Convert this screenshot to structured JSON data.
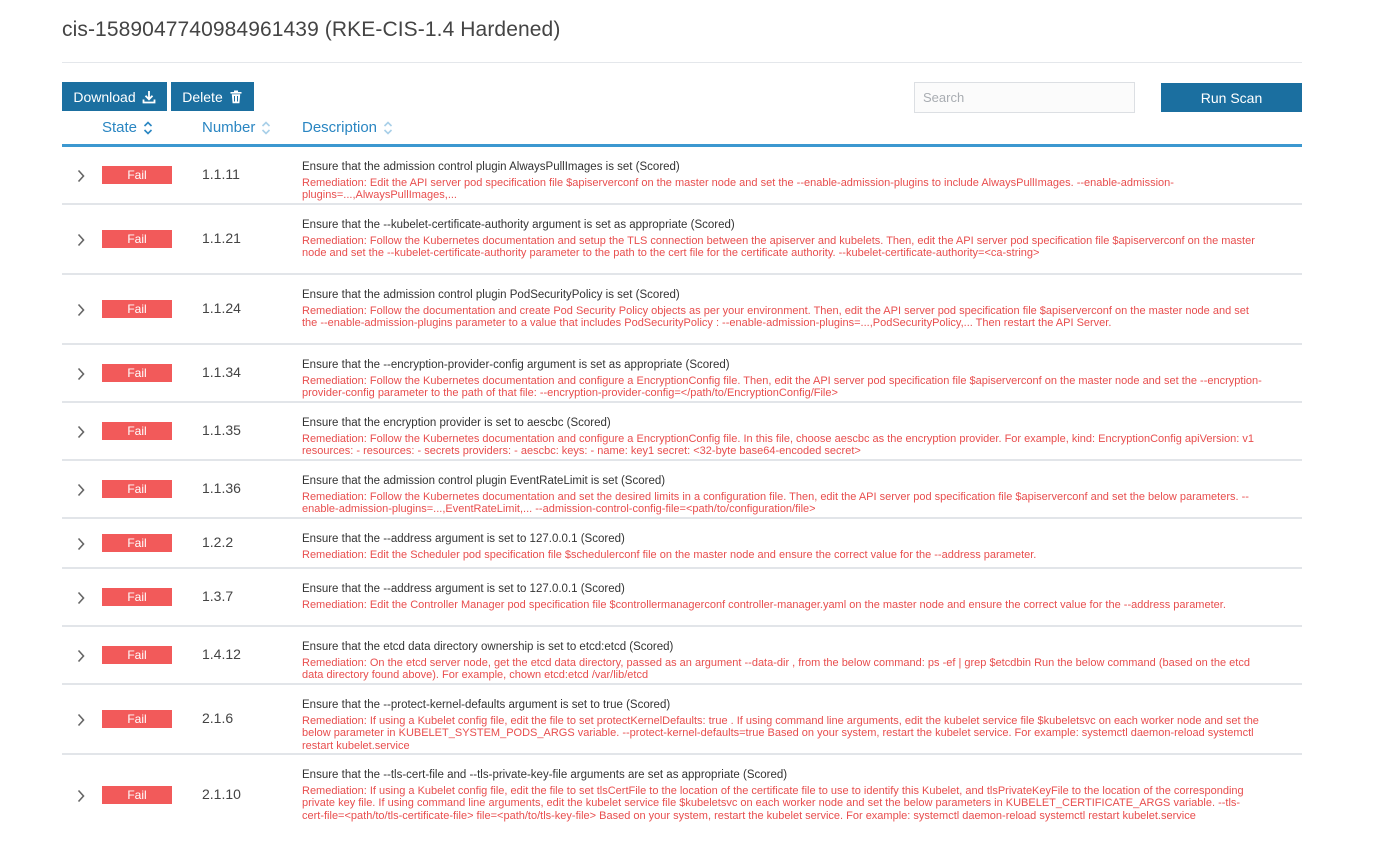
{
  "page": {
    "title": "cis-1589047740984961439 (RKE-CIS-1.4 Hardened)"
  },
  "toolbar": {
    "download_label": "Download",
    "delete_label": "Delete",
    "run_scan_label": "Run Scan",
    "search_placeholder": "Search"
  },
  "columns": {
    "state": "State",
    "number": "Number",
    "description": "Description"
  },
  "colors": {
    "primary": "#1b6fa0",
    "fail": "#f25a5a",
    "link": "#2a86c2"
  },
  "rows": [
    {
      "state": "Fail",
      "number": "1.1.11",
      "title": "Ensure that the admission control plugin AlwaysPullImages is set (Scored)",
      "remediation": "Remediation: Edit the API server pod specification file $apiserverconf on the master node and set the --enable-admission-plugins to include AlwaysPullImages. --enable-admission-plugins=...,AlwaysPullImages,..."
    },
    {
      "state": "Fail",
      "number": "1.1.21",
      "title": "Ensure that the --kubelet-certificate-authority argument is set as appropriate (Scored)",
      "remediation": "Remediation: Follow the Kubernetes documentation and setup the TLS connection between the apiserver and kubelets. Then, edit the API server pod specification file $apiserverconf on the master node and set the --kubelet-certificate-authority parameter to the path to the cert file for the certificate authority. --kubelet-certificate-authority=<ca-string>"
    },
    {
      "state": "Fail",
      "number": "1.1.24",
      "title": "Ensure that the admission control plugin PodSecurityPolicy is set (Scored)",
      "remediation": "Remediation: Follow the documentation and create Pod Security Policy objects as per your environment. Then, edit the API server pod specification file $apiserverconf on the master node and set the --enable-admission-plugins parameter to a value that includes PodSecurityPolicy : --enable-admission-plugins=...,PodSecurityPolicy,... Then restart the API Server."
    },
    {
      "state": "Fail",
      "number": "1.1.34",
      "title": "Ensure that the --encryption-provider-config argument is set as appropriate (Scored)",
      "remediation": "Remediation: Follow the Kubernetes documentation and configure a EncryptionConfig file. Then, edit the API server pod specification file $apiserverconf on the master node and set the --encryption-provider-config parameter to the path of that file: --encryption-provider-config=</path/to/EncryptionConfig/File>"
    },
    {
      "state": "Fail",
      "number": "1.1.35",
      "title": "Ensure that the encryption provider is set to aescbc (Scored)",
      "remediation": "Remediation: Follow the Kubernetes documentation and configure a EncryptionConfig file. In this file, choose aescbc as the encryption provider. For example, kind: EncryptionConfig apiVersion: v1 resources: - resources: - secrets providers: - aescbc: keys: - name: key1 secret: <32-byte base64-encoded secret>"
    },
    {
      "state": "Fail",
      "number": "1.1.36",
      "title": "Ensure that the admission control plugin EventRateLimit is set (Scored)",
      "remediation": "Remediation: Follow the Kubernetes documentation and set the desired limits in a configuration file. Then, edit the API server pod specification file $apiserverconf and set the below parameters. --enable-admission-plugins=...,EventRateLimit,... --admission-control-config-file=<path/to/configuration/file>"
    },
    {
      "state": "Fail",
      "number": "1.2.2",
      "title": "Ensure that the --address argument is set to 127.0.0.1 (Scored)",
      "remediation": "Remediation: Edit the Scheduler pod specification file $schedulerconf file on the master node and ensure the correct value for the --address parameter."
    },
    {
      "state": "Fail",
      "number": "1.3.7",
      "title": "Ensure that the --address argument is set to 127.0.0.1 (Scored)",
      "remediation": "Remediation: Edit the Controller Manager pod specification file $controllermanagerconf controller-manager.yaml on the master node and ensure the correct value for the --address parameter."
    },
    {
      "state": "Fail",
      "number": "1.4.12",
      "title": "Ensure that the etcd data directory ownership is set to etcd:etcd (Scored)",
      "remediation": "Remediation: On the etcd server node, get the etcd data directory, passed as an argument --data-dir , from the below command: ps -ef | grep $etcdbin Run the below command (based on the etcd data directory found above). For example, chown etcd:etcd /var/lib/etcd"
    },
    {
      "state": "Fail",
      "number": "2.1.6",
      "title": "Ensure that the --protect-kernel-defaults argument is set to true (Scored)",
      "remediation": "Remediation: If using a Kubelet config file, edit the file to set protectKernelDefaults: true . If using command line arguments, edit the kubelet service file $kubeletsvc on each worker node and set the below parameter in KUBELET_SYSTEM_PODS_ARGS variable. --protect-kernel-defaults=true Based on your system, restart the kubelet service. For example: systemctl daemon-reload systemctl restart kubelet.service"
    },
    {
      "state": "Fail",
      "number": "2.1.10",
      "title": "Ensure that the --tls-cert-file and --tls-private-key-file arguments are set as appropriate (Scored)",
      "remediation": "Remediation: If using a Kubelet config file, edit the file to set tlsCertFile to the location of the certificate file to use to identify this Kubelet, and tlsPrivateKeyFile to the location of the corresponding private key file. If using command line arguments, edit the kubelet service file $kubeletsvc on each worker node and set the below parameters in KUBELET_CERTIFICATE_ARGS variable. --tls-cert-file=<path/to/tls-certificate-file> file=<path/to/tls-key-file> Based on your system, restart the kubelet service. For example: systemctl daemon-reload systemctl restart kubelet.service"
    }
  ]
}
